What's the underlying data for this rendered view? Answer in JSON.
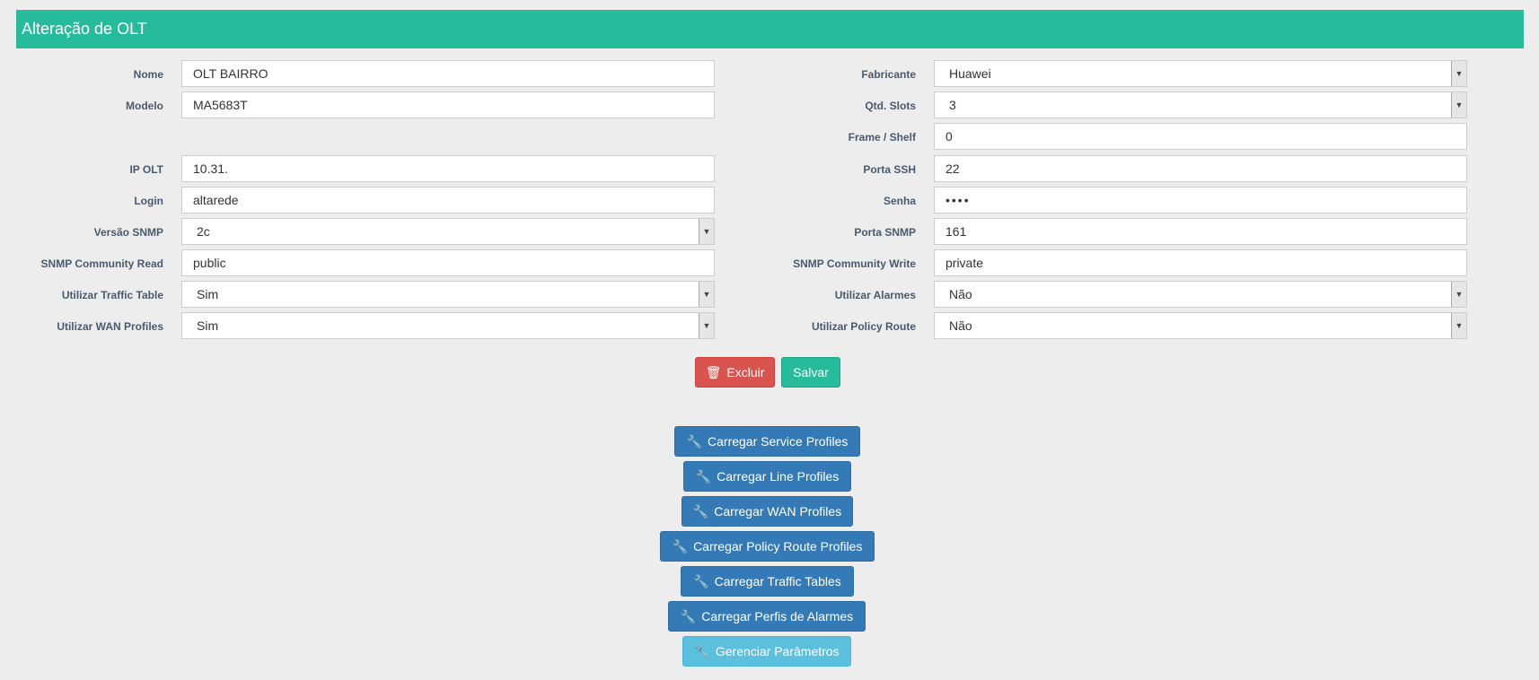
{
  "header": {
    "title": "Alteração de OLT"
  },
  "left": [
    {
      "label": "Nome",
      "value": "OLT BAIRRO"
    },
    {
      "label": "Modelo",
      "value": "MA5683T"
    },
    {
      "label": "IP OLT",
      "value": "10.31."
    },
    {
      "label": "Login",
      "value": "altarede"
    },
    {
      "label": "Versão SNMP",
      "value": "2c"
    },
    {
      "label": "SNMP Community Read",
      "value": "public"
    },
    {
      "label": "Utilizar Traffic Table",
      "value": "Sim"
    },
    {
      "label": "Utilizar WAN Profiles",
      "value": "Sim"
    }
  ],
  "right": [
    {
      "label": "Fabricante",
      "value": "Huawei"
    },
    {
      "label": "Qtd. Slots",
      "value": "3"
    },
    {
      "label": "Frame / Shelf",
      "value": "0"
    },
    {
      "label": "Porta SSH",
      "value": "22"
    },
    {
      "label": "Senha",
      "value": "••••"
    },
    {
      "label": "Porta SNMP",
      "value": "161"
    },
    {
      "label": "SNMP Community Write",
      "value": "private"
    },
    {
      "label": "Utilizar Alarmes",
      "value": "Não"
    },
    {
      "label": "Utilizar Policy Route",
      "value": "Não"
    }
  ],
  "actions": {
    "delete_label": "Excluir",
    "save_label": "Salvar"
  },
  "tools": [
    "Carregar Service Profiles",
    "Carregar Line Profiles",
    "Carregar WAN Profiles",
    "Carregar Policy Route Profiles",
    "Carregar Traffic Tables",
    "Carregar Perfis de Alarmes",
    "Gerenciar Parâmetros"
  ],
  "icons": {
    "delete": "trash-icon",
    "tool": "wrench-icon",
    "select": "chevron-down-icon"
  }
}
